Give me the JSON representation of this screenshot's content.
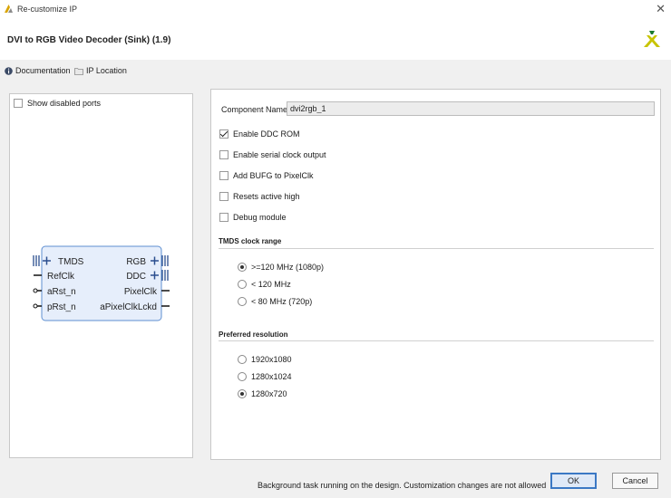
{
  "window": {
    "title": "Re-customize IP",
    "close_glyph": "✕"
  },
  "header": {
    "ip_title": "DVI to RGB Video Decoder (Sink) (1.9)",
    "logo": "xilinx-logo"
  },
  "links": {
    "documentation": "Documentation",
    "ip_location": "IP Location"
  },
  "left_panel": {
    "show_disabled_ports": {
      "label": "Show disabled ports",
      "checked": false
    },
    "block": {
      "left_ports": [
        "TMDS",
        "RefClk",
        "aRst_n",
        "pRst_n"
      ],
      "right_ports": [
        "RGB",
        "DDC",
        "PixelClk",
        "aPixelClkLckd"
      ]
    }
  },
  "right_panel": {
    "component_name_label": "Component Name",
    "component_name_value": "dvi2rgb_1",
    "options": [
      {
        "label": "Enable DDC ROM",
        "checked": true
      },
      {
        "label": "Enable serial clock output",
        "checked": false
      },
      {
        "label": "Add BUFG to PixelClk",
        "checked": false
      },
      {
        "label": "Resets active high",
        "checked": false
      },
      {
        "label": "Debug module",
        "checked": false
      }
    ],
    "tmds_section": {
      "title": "TMDS clock range",
      "choices": [
        {
          "label": ">=120 MHz (1080p)",
          "selected": true
        },
        {
          "label": "< 120 MHz",
          "selected": false
        },
        {
          "label": "< 80 MHz (720p)",
          "selected": false
        }
      ]
    },
    "resolution_section": {
      "title": "Preferred resolution",
      "choices": [
        {
          "label": "1920x1080",
          "selected": false
        },
        {
          "label": "1280x1024",
          "selected": false
        },
        {
          "label": "1280x720",
          "selected": true
        }
      ]
    }
  },
  "footer": {
    "status": "Background task running on the design. Customization changes are not allowed",
    "ok_label": "OK",
    "cancel_label": "Cancel"
  },
  "colors": {
    "ok_border": "#3b78c4",
    "block_fill": "#e6eefb",
    "block_stroke": "#5e8fd1",
    "logo_yellow": "#c8c400"
  }
}
